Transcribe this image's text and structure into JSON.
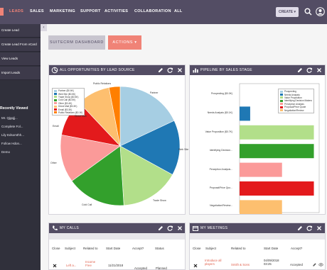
{
  "nav": {
    "items": [
      "LEADS",
      "SALES",
      "MARKETING",
      "SUPPORT",
      "ACTIVITIES",
      "COLLABORATION",
      "ALL"
    ],
    "active": "LEADS",
    "create_label": "CREATE ▾"
  },
  "sidebar": {
    "actions": [
      "Create Lead",
      "Create Lead From vCard",
      "View Leads",
      "Import Leads"
    ],
    "recently_viewed_title": "Recently Viewed",
    "recent_items": [
      "Mr. Qjgqjj...",
      "Complete Fol...",
      "Lily Edsomthh...",
      "Follow Hdon...",
      "Demo"
    ]
  },
  "tabs": {
    "dashboard": "SUITECRM DASHBOARD",
    "actions": "ACTIONS ▾"
  },
  "dashlets": {
    "opportunities": {
      "title": "ALL OPPORTUNITIES BY LEAD SOURCE"
    },
    "pipeline": {
      "title": "PIPELINE BY SALES STAGE"
    },
    "calls": {
      "title": "MY CALLS",
      "columns": [
        "Close",
        "Subject",
        "Related to",
        "Start Date",
        "Accept?",
        "Status"
      ],
      "rows": [
        {
          "subject": "Left a...",
          "related": "Income Free",
          "date": "11/21/2018",
          "accept": "Accepted",
          "status": "Planned"
        }
      ]
    },
    "meetings": {
      "title": "MY MEETINGS",
      "columns": [
        "Close",
        "Subject",
        "Related to",
        "Start Date",
        "Accept?"
      ],
      "rows": [
        {
          "subject": "Introduce all players",
          "related": "Smith & Sons",
          "date": "04/09/2018 03:25",
          "accept": "Accepted"
        }
      ]
    }
  },
  "chart_data": [
    {
      "type": "pie",
      "title": "ALL OPPORTUNITIES BY LEAD SOURCE",
      "legend_position": "top-left",
      "slices": [
        {
          "name": "Partner",
          "value": 18,
          "color": "#a6cee3"
        },
        {
          "name": "Web Site",
          "value": 15,
          "color": "#1f78b4"
        },
        {
          "name": "Trade Show",
          "value": 16,
          "color": "#b2df8a"
        },
        {
          "name": "Cold Call",
          "value": 16,
          "color": "#33a02c"
        },
        {
          "name": "Other",
          "value": 13,
          "color": "#fb9a99"
        },
        {
          "name": "Email",
          "value": 10,
          "color": "#e31a1c"
        },
        {
          "name": "Direct Mail",
          "value": 9,
          "color": "#fdbf6f"
        },
        {
          "name": "Public Relations",
          "value": 3,
          "color": "#ff7f00"
        }
      ],
      "legend": [
        "Partner ($0.6K)",
        "Web Site ($0.5K)",
        "Trade Show ($0.5K)",
        "Cold Call ($0.5K)",
        "Other ($0.4K)",
        "Direct Mail ($0.3K)",
        "Email ($0.3K)",
        "Public Relations ($0.1K)"
      ],
      "labels": [
        "Public Relations",
        "Partner",
        "Web Site",
        "Trade Show",
        "Cold Call",
        "Other",
        "Email",
        "Direct Mail"
      ]
    },
    {
      "type": "bar",
      "orientation": "horizontal",
      "title": "PIPELINE BY SALES STAGE",
      "legend_position": "top-right",
      "categories": [
        "Prospecting ($0.0K)",
        "Needs Analysis ($0.1K)",
        "Value Proposition ($0.7K)",
        "Identifying Decision...",
        "Perception Analysis...",
        "Proposal/Price Quo...",
        "Negotiation/Review..."
      ],
      "values": [
        0.0,
        0.1,
        0.7,
        0.7,
        0.4,
        0.7,
        0.4
      ],
      "colors": [
        "#a6cee3",
        "#1f78b4",
        "#b2df8a",
        "#33a02c",
        "#fb9a99",
        "#e31a1c",
        "#fdbf6f"
      ],
      "legend": [
        "Prospecting",
        "Needs Analysis",
        "Value Proposition",
        "Identifying Decision Makers",
        "Perception Analysis",
        "Proposal/Price Quote",
        "Negotiation/Review"
      ],
      "xlim": [
        0,
        0.75
      ]
    }
  ]
}
